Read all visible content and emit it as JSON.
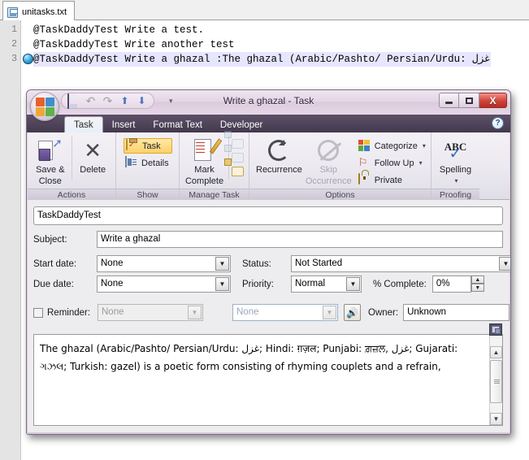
{
  "editor": {
    "tab": {
      "label": "unitasks.txt",
      "icon": "save-file-icon"
    },
    "lines": [
      {
        "num": "1",
        "text": "@TaskDaddyTest Write a test.",
        "bookmark": false,
        "highlight": false
      },
      {
        "num": "2",
        "text": "@TaskDaddyTest Write another test",
        "bookmark": false,
        "highlight": false
      },
      {
        "num": "3",
        "text": "@TaskDaddyTest Write a ghazal :The ghazal (Arabic/Pashto/ Persian/Urdu: غزل",
        "bookmark": true,
        "highlight": true
      }
    ]
  },
  "task_window": {
    "title": "Write a ghazal  -  Task",
    "office_button": "Office",
    "quick_access": [
      {
        "name": "save-icon",
        "label": "Save"
      },
      {
        "name": "undo-icon",
        "label": "Undo",
        "glyph": "↶"
      },
      {
        "name": "redo-icon",
        "label": "Redo",
        "glyph": "↷"
      },
      {
        "name": "previous-item-icon",
        "label": "Previous Item",
        "glyph": "⬆"
      },
      {
        "name": "next-item-icon",
        "label": "Next Item",
        "glyph": "⬇"
      },
      {
        "name": "customize-qat-icon",
        "label": "Customize Quick Access Toolbar",
        "glyph": "▾"
      }
    ],
    "window_controls": {
      "minimize": "Minimize",
      "maximize": "Maximize",
      "close": "X"
    },
    "help_button": "?",
    "ribbon_tabs": [
      {
        "label": "Task",
        "active": true
      },
      {
        "label": "Insert",
        "active": false
      },
      {
        "label": "Format Text",
        "active": false
      },
      {
        "label": "Developer",
        "active": false
      }
    ],
    "ribbon_groups": [
      {
        "label": "Actions",
        "buttons": [
          {
            "label": "Save &\nClose",
            "line1": "Save &",
            "line2": "Close",
            "icon": "save-and-close-icon",
            "enabled": true
          },
          {
            "label": "Delete",
            "line1": "Delete",
            "line2": "",
            "icon": "delete-x-icon",
            "enabled": true
          }
        ]
      },
      {
        "label": "Show",
        "buttons": [
          {
            "label": "Task",
            "icon": "task-clipboard-icon",
            "selected": true,
            "enabled": true
          },
          {
            "label": "Details",
            "icon": "details-page-icon",
            "selected": false,
            "enabled": true
          }
        ]
      },
      {
        "label": "Manage Task",
        "buttons": [
          {
            "line1": "Mark",
            "line2": "Complete",
            "icon": "mark-complete-icon",
            "enabled": true
          },
          {
            "label": "Assign Task",
            "icon": "assign-task-icon",
            "enabled": false
          },
          {
            "label": "Send Status Report",
            "icon": "send-status-report-icon",
            "enabled": false
          },
          {
            "label": "Reply Forward",
            "icon": "forward-task-icon",
            "enabled": true
          }
        ]
      },
      {
        "label": "Options",
        "buttons": [
          {
            "label": "Recurrence",
            "icon": "recurrence-icon",
            "enabled": true
          },
          {
            "line1": "Skip",
            "line2": "Occurrence",
            "icon": "skip-occurrence-icon",
            "enabled": false
          },
          {
            "label": "Categorize",
            "icon": "categorize-icon",
            "dropdown": true,
            "enabled": true
          },
          {
            "label": "Follow Up",
            "icon": "follow-up-flag-icon",
            "dropdown": true,
            "enabled": true
          },
          {
            "label": "Private",
            "icon": "private-lock-icon",
            "enabled": true
          }
        ]
      },
      {
        "label": "Proofing",
        "buttons": [
          {
            "label": "Spelling",
            "icon": "spelling-abc-check-icon",
            "dropdown": true,
            "enabled": true
          }
        ]
      }
    ],
    "form": {
      "info_bar": "TaskDaddyTest",
      "subject_label": "Subject:",
      "subject_value": "Write a ghazal",
      "start_date_label": "Start date:",
      "start_date_value": "None",
      "status_label": "Status:",
      "status_value": "Not Started",
      "due_date_label": "Due date:",
      "due_date_value": "None",
      "priority_label": "Priority:",
      "priority_value": "Normal",
      "percent_complete_label": "% Complete:",
      "percent_complete_value": "0%",
      "reminder_label": "Reminder:",
      "reminder_date_value": "None",
      "reminder_time_value": "None",
      "reminder_checked": false,
      "sound_button": "sound-icon",
      "owner_label": "Owner:",
      "owner_value": "Unknown",
      "body_text": "The ghazal (Arabic/Pashto/ Persian/Urdu: غزل; Hindi: ग़ज़ल; Punjabi: ਗ਼ਜ਼ਲ, غزل; Gujarati: ગઝલ; Turkish: gazel) is a poetic form consisting of rhyming couplets and a refrain,",
      "body_scrollbar": {
        "up_arrow": "▲",
        "down_arrow": "▼",
        "attachment_tab": "attachment-icon"
      }
    }
  },
  "colors": {
    "accent_orange": "#f0a030",
    "window_chrome": "#e3d5e4",
    "ribbon_tab_bar": "#5d5168",
    "close_button": "#cf4238",
    "highlight_line": "#e6e6ff"
  }
}
